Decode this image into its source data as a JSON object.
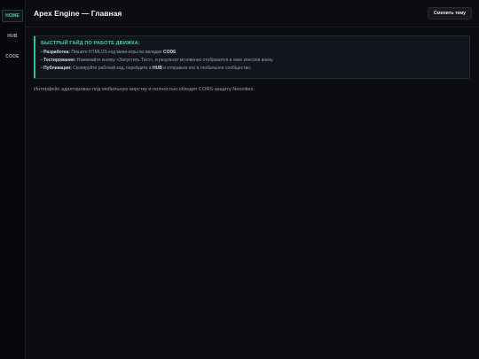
{
  "sidebar": {
    "items": [
      {
        "label": "HOME",
        "active": true
      },
      {
        "label": "HUB",
        "active": false
      },
      {
        "label": "CODE",
        "active": false
      }
    ]
  },
  "header": {
    "title": "Apex Engine — Главная",
    "theme_button_label": "Сменить тему"
  },
  "guide": {
    "title": "БЫСТРЫЙ ГАЙД ПО РАБОТЕ ДВИЖКА:",
    "items": [
      {
        "bullet": "•",
        "bold": "Разработка:",
        "text": " Пишите HTML/JS код мини-игры во вкладке ",
        "bold2": "CODE",
        "text2": "."
      },
      {
        "bullet": "•",
        "bold": "Тестирование:",
        "text": " Нажимайте кнопку «Запустить Тест», и результат мгновенно отобразится в окне консоли внизу.",
        "bold2": "",
        "text2": ""
      },
      {
        "bullet": "•",
        "bold": "Публикация:",
        "text": " Скопируйте рабочий код, перейдите в ",
        "bold2": "HUB",
        "text2": " и отправьте его в глобальное сообщество."
      }
    ]
  },
  "note": "Интерфейс адаптирован под мобильную верстку и полностью обходит CORS-защиту Neocities.",
  "colors": {
    "accent": "#38d2b0",
    "background": "#0b0d11",
    "sidebar": "#07080b",
    "panel": "#12151b"
  }
}
